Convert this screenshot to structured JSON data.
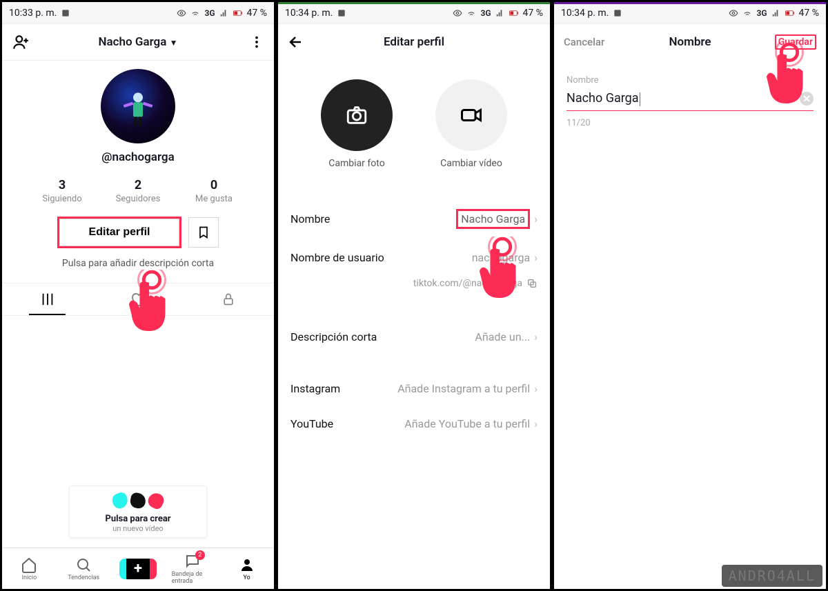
{
  "statusbar": {
    "time1": "10:33 p. m.",
    "time2": "10:34 p. m.",
    "time3": "10:34 p. m.",
    "network": "3G",
    "battery": "47 %"
  },
  "screen1": {
    "header_name": "Nacho Garga",
    "username": "@nachogarga",
    "stats": {
      "following_num": "3",
      "following_lbl": "Siguiendo",
      "followers_num": "2",
      "followers_lbl": "Seguidores",
      "likes_num": "0",
      "likes_lbl": "Me gusta"
    },
    "edit_profile": "Editar perfil",
    "bio_hint": "Pulsa para añadir descripción corta",
    "create_card_title": "Pulsa para crear",
    "create_card_sub": "un nuevo vídeo",
    "nav": {
      "home": "Inicio",
      "discover": "Tendencias",
      "inbox": "Bandeja de entrada",
      "inbox_badge": "2",
      "me": "Yo"
    }
  },
  "screen2": {
    "title": "Editar perfil",
    "change_photo": "Cambiar foto",
    "change_video": "Cambiar vídeo",
    "fields": {
      "name_label": "Nombre",
      "name_value": "Nacho Garga",
      "username_label": "Nombre de usuario",
      "username_value": "nachogarga",
      "profile_link": "tiktok.com/@nachogarga",
      "bio_label": "Descripción corta",
      "bio_value": "Añade un...",
      "instagram_label": "Instagram",
      "instagram_value": "Añade Instagram a tu perfil",
      "youtube_label": "YouTube",
      "youtube_value": "Añade YouTube a tu perfil"
    }
  },
  "screen3": {
    "cancel": "Cancelar",
    "title": "Nombre",
    "save": "Guardar",
    "field_label": "Nombre",
    "field_value": "Nacho Garga",
    "counter": "11/20"
  },
  "watermark": "ANDRO4ALL"
}
